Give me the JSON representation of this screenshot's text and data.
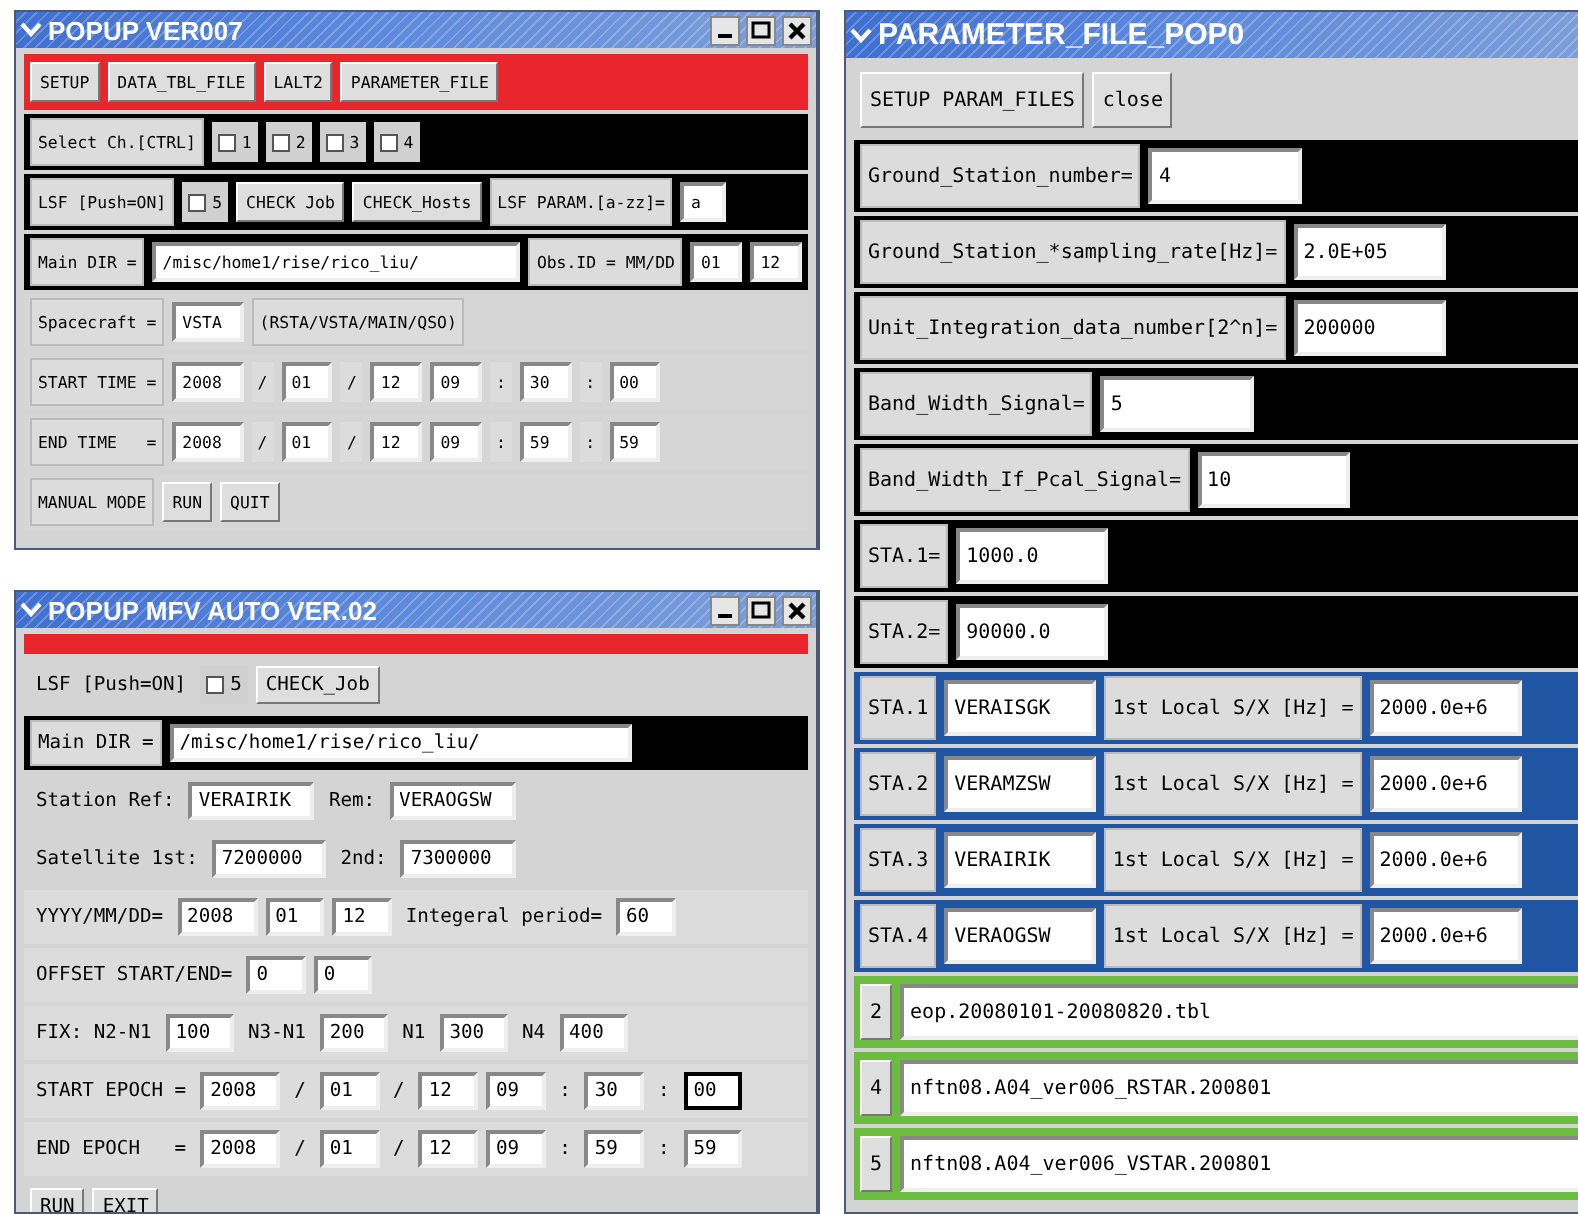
{
  "windows": [
    {
      "title": "POPUP VER007",
      "controls": true,
      "rows": [
        {
          "color": "#e8262b",
          "items": [
            {
              "kind": "button",
              "text": "SETUP"
            },
            {
              "kind": "button",
              "text": "DATA_TBL_FILE"
            },
            {
              "kind": "button",
              "text": "LALT2"
            },
            {
              "kind": "button",
              "text": "PARAMETER_FILE"
            }
          ]
        },
        {
          "color": "#000000",
          "items": [
            {
              "kind": "label",
              "text": "Select Ch.[CTRL]"
            },
            {
              "kind": "checkbox",
              "text": "1",
              "checked": false
            },
            {
              "kind": "checkbox",
              "text": "2",
              "checked": false
            },
            {
              "kind": "checkbox",
              "text": "3",
              "checked": false
            },
            {
              "kind": "checkbox",
              "text": "4",
              "checked": false
            }
          ]
        },
        {
          "color": "#000000",
          "items": [
            {
              "kind": "label",
              "text": "LSF [Push=ON]"
            },
            {
              "kind": "checkbox",
              "text": "5",
              "checked": false
            },
            {
              "kind": "button",
              "text": "CHECK Job"
            },
            {
              "kind": "button",
              "text": "CHECK_Hosts"
            },
            {
              "kind": "label",
              "text": "LSF PARAM.[a-zz]="
            },
            {
              "kind": "field",
              "value": "a"
            }
          ]
        },
        {
          "color": "#000000",
          "items": [
            {
              "kind": "label",
              "text": "Main DIR ="
            },
            {
              "kind": "wide-field",
              "value": "/misc/home1/rise/rico_liu/"
            },
            {
              "kind": "label",
              "text": "Obs.ID = MM/DD"
            },
            {
              "kind": "field",
              "value": "01"
            },
            {
              "kind": "field",
              "value": "12"
            }
          ]
        },
        {
          "color": "#d6d6d6",
          "items": [
            {
              "kind": "label",
              "text": "Spacecraft ="
            },
            {
              "kind": "field",
              "value": "VSTA"
            },
            {
              "kind": "label",
              "text": "(RSTA/VSTA/MAIN/QSO)"
            }
          ]
        },
        {
          "color": "#d6d6d6",
          "items": [
            {
              "kind": "label",
              "text": "START TIME ="
            },
            {
              "kind": "field",
              "value": "2008"
            },
            {
              "kind": "sep",
              "text": "/"
            },
            {
              "kind": "field",
              "value": "01"
            },
            {
              "kind": "sep",
              "text": "/"
            },
            {
              "kind": "field",
              "value": "12"
            },
            {
              "kind": "field",
              "value": "09"
            },
            {
              "kind": "sep",
              "text": ":"
            },
            {
              "kind": "field",
              "value": "30"
            },
            {
              "kind": "sep",
              "text": ":"
            },
            {
              "kind": "field",
              "value": "00"
            }
          ]
        },
        {
          "color": "#d6d6d6",
          "items": [
            {
              "kind": "label",
              "text": "END TIME   ="
            },
            {
              "kind": "field",
              "value": "2008"
            },
            {
              "kind": "sep",
              "text": "/"
            },
            {
              "kind": "field",
              "value": "01"
            },
            {
              "kind": "sep",
              "text": "/"
            },
            {
              "kind": "field",
              "value": "12"
            },
            {
              "kind": "field",
              "value": "09"
            },
            {
              "kind": "sep",
              "text": ":"
            },
            {
              "kind": "field",
              "value": "59"
            },
            {
              "kind": "sep",
              "text": ":"
            },
            {
              "kind": "field",
              "value": "59"
            }
          ]
        },
        {
          "color": "#d6d6d6",
          "items": [
            {
              "kind": "label",
              "text": "MANUAL MODE"
            },
            {
              "kind": "button",
              "text": "RUN"
            },
            {
              "kind": "button",
              "text": "QUIT"
            }
          ]
        }
      ]
    },
    {
      "title": "POPUP MFV AUTO VER.02",
      "controls": true,
      "rows": [
        {
          "color": "#e8262b",
          "items": []
        },
        {
          "color": "#d4d4d4",
          "items": [
            {
              "kind": "text",
              "text": "LSF [Push=ON]"
            },
            {
              "kind": "checkbox",
              "text": "5",
              "checked": false
            },
            {
              "kind": "button",
              "text": "CHECK_Job"
            }
          ]
        },
        {
          "color": "#000000",
          "items": [
            {
              "kind": "label",
              "text": "Main DIR ="
            },
            {
              "kind": "wide-field",
              "value": "/misc/home1/rise/rico_liu/"
            }
          ]
        },
        {
          "color": "#d4d4d4",
          "items": [
            {
              "kind": "text",
              "text": "Station Ref:"
            },
            {
              "kind": "field",
              "value": "VERAIRIK"
            },
            {
              "kind": "text",
              "text": "Rem:"
            },
            {
              "kind": "field",
              "value": "VERAOGSW"
            }
          ]
        },
        {
          "color": "#d4d4d4",
          "items": [
            {
              "kind": "text",
              "text": "Satellite 1st:"
            },
            {
              "kind": "field",
              "value": "7200000"
            },
            {
              "kind": "text",
              "text": "2nd:"
            },
            {
              "kind": "field",
              "value": "7300000"
            }
          ]
        },
        {
          "color": "#dcdcdc",
          "items": [
            {
              "kind": "text",
              "text": "YYYY/MM/DD="
            },
            {
              "kind": "field",
              "value": "2008"
            },
            {
              "kind": "field",
              "value": "01"
            },
            {
              "kind": "field",
              "value": "12"
            },
            {
              "kind": "text",
              "text": "Integeral period="
            },
            {
              "kind": "field",
              "value": "60"
            }
          ]
        },
        {
          "color": "#dcdcdc",
          "items": [
            {
              "kind": "text",
              "text": "OFFSET START/END="
            },
            {
              "kind": "field",
              "value": "0"
            },
            {
              "kind": "field",
              "value": "0"
            }
          ]
        },
        {
          "color": "#dcdcdc",
          "items": [
            {
              "kind": "text",
              "text": "FIX: N2-N1"
            },
            {
              "kind": "field",
              "value": "100"
            },
            {
              "kind": "text",
              "text": "N3-N1"
            },
            {
              "kind": "field",
              "value": "200"
            },
            {
              "kind": "text",
              "text": "N1"
            },
            {
              "kind": "field",
              "value": "300"
            },
            {
              "kind": "text",
              "text": "N4"
            },
            {
              "kind": "field",
              "value": "400"
            }
          ]
        },
        {
          "color": "#dcdcdc",
          "items": [
            {
              "kind": "text",
              "text": "START EPOCH ="
            },
            {
              "kind": "field",
              "value": "2008"
            },
            {
              "kind": "sep",
              "text": "/"
            },
            {
              "kind": "field",
              "value": "01"
            },
            {
              "kind": "sep",
              "text": "/"
            },
            {
              "kind": "field",
              "value": "12"
            },
            {
              "kind": "field",
              "value": "09"
            },
            {
              "kind": "sep",
              "text": ":"
            },
            {
              "kind": "field",
              "value": "30"
            },
            {
              "kind": "sep",
              "text": ":"
            },
            {
              "kind": "field",
              "value": "00",
              "focused": true
            }
          ]
        },
        {
          "color": "#dcdcdc",
          "items": [
            {
              "kind": "text",
              "text": "END EPOCH   ="
            },
            {
              "kind": "field",
              "value": "2008"
            },
            {
              "kind": "sep",
              "text": "/"
            },
            {
              "kind": "field",
              "value": "01"
            },
            {
              "kind": "sep",
              "text": "/"
            },
            {
              "kind": "field",
              "value": "12"
            },
            {
              "kind": "field",
              "value": "09"
            },
            {
              "kind": "sep",
              "text": ":"
            },
            {
              "kind": "field",
              "value": "59"
            },
            {
              "kind": "sep",
              "text": ":"
            },
            {
              "kind": "field",
              "value": "59"
            }
          ]
        },
        {
          "color": "#d4d4d4",
          "items": [
            {
              "kind": "button",
              "text": "RUN"
            },
            {
              "kind": "button",
              "text": "EXIT"
            }
          ]
        }
      ]
    },
    {
      "title": "PARAMETER_FILE_POP0",
      "controls": false,
      "rows": [
        {
          "color": "#d4d4d4",
          "items": [
            {
              "kind": "button",
              "text": "SETUP PARAM_FILES"
            },
            {
              "kind": "button",
              "text": "close"
            }
          ]
        },
        {
          "color": "#000000",
          "items": [
            {
              "kind": "label",
              "text": "Ground_Station_number="
            },
            {
              "kind": "field",
              "value": "4"
            }
          ]
        },
        {
          "color": "#000000",
          "items": [
            {
              "kind": "label",
              "text": "Ground_Station_*sampling_rate[Hz]="
            },
            {
              "kind": "field",
              "value": "2.0E+05"
            }
          ]
        },
        {
          "color": "#000000",
          "items": [
            {
              "kind": "label",
              "text": "Unit_Integration_data_number[2^n]="
            },
            {
              "kind": "field",
              "value": "200000"
            }
          ]
        },
        {
          "color": "#000000",
          "items": [
            {
              "kind": "label",
              "text": "Band_Width_Signal="
            },
            {
              "kind": "field",
              "value": "5"
            }
          ]
        },
        {
          "color": "#000000",
          "items": [
            {
              "kind": "label",
              "text": "Band_Width_If_Pcal_Signal="
            },
            {
              "kind": "field",
              "value": "10"
            }
          ]
        },
        {
          "color": "#000000",
          "items": [
            {
              "kind": "label",
              "text": "STA.1="
            },
            {
              "kind": "field",
              "value": "1000.0"
            }
          ]
        },
        {
          "color": "#000000",
          "items": [
            {
              "kind": "label",
              "text": "STA.2="
            },
            {
              "kind": "field",
              "value": "90000.0"
            }
          ]
        },
        {
          "color": "#2156a5",
          "items": [
            {
              "kind": "label",
              "text": "STA.1"
            },
            {
              "kind": "field",
              "value": "VERAISGK"
            },
            {
              "kind": "label",
              "text": "1st Local S/X [Hz] ="
            },
            {
              "kind": "field",
              "value": "2000.0e+6"
            }
          ]
        },
        {
          "color": "#2156a5",
          "items": [
            {
              "kind": "label",
              "text": "STA.2"
            },
            {
              "kind": "field",
              "value": "VERAMZSW"
            },
            {
              "kind": "label",
              "text": "1st Local S/X [Hz] ="
            },
            {
              "kind": "field",
              "value": "2000.0e+6"
            }
          ]
        },
        {
          "color": "#2156a5",
          "items": [
            {
              "kind": "label",
              "text": "STA.3"
            },
            {
              "kind": "field",
              "value": "VERAIRIK"
            },
            {
              "kind": "label",
              "text": "1st Local S/X [Hz] ="
            },
            {
              "kind": "field",
              "value": "2000.0e+6"
            }
          ]
        },
        {
          "color": "#2156a5",
          "items": [
            {
              "kind": "label",
              "text": "STA.4"
            },
            {
              "kind": "field",
              "value": "VERAOGSW"
            },
            {
              "kind": "label",
              "text": "1st Local S/X [Hz] ="
            },
            {
              "kind": "field",
              "value": "2000.0e+6"
            }
          ]
        },
        {
          "color": "#6cbd3f",
          "items": [
            {
              "kind": "button",
              "text": "2"
            },
            {
              "kind": "long-field",
              "value": "eop.20080101-20080820.tbl"
            }
          ]
        },
        {
          "color": "#6cbd3f",
          "items": [
            {
              "kind": "button",
              "text": "4"
            },
            {
              "kind": "long-field",
              "value": "nftn08.A04_ver006_RSTAR.200801"
            }
          ]
        },
        {
          "color": "#6cbd3f",
          "items": [
            {
              "kind": "button",
              "text": "5"
            },
            {
              "kind": "long-field",
              "value": "nftn08.A04_ver006_VSTAR.200801"
            }
          ]
        }
      ]
    }
  ]
}
